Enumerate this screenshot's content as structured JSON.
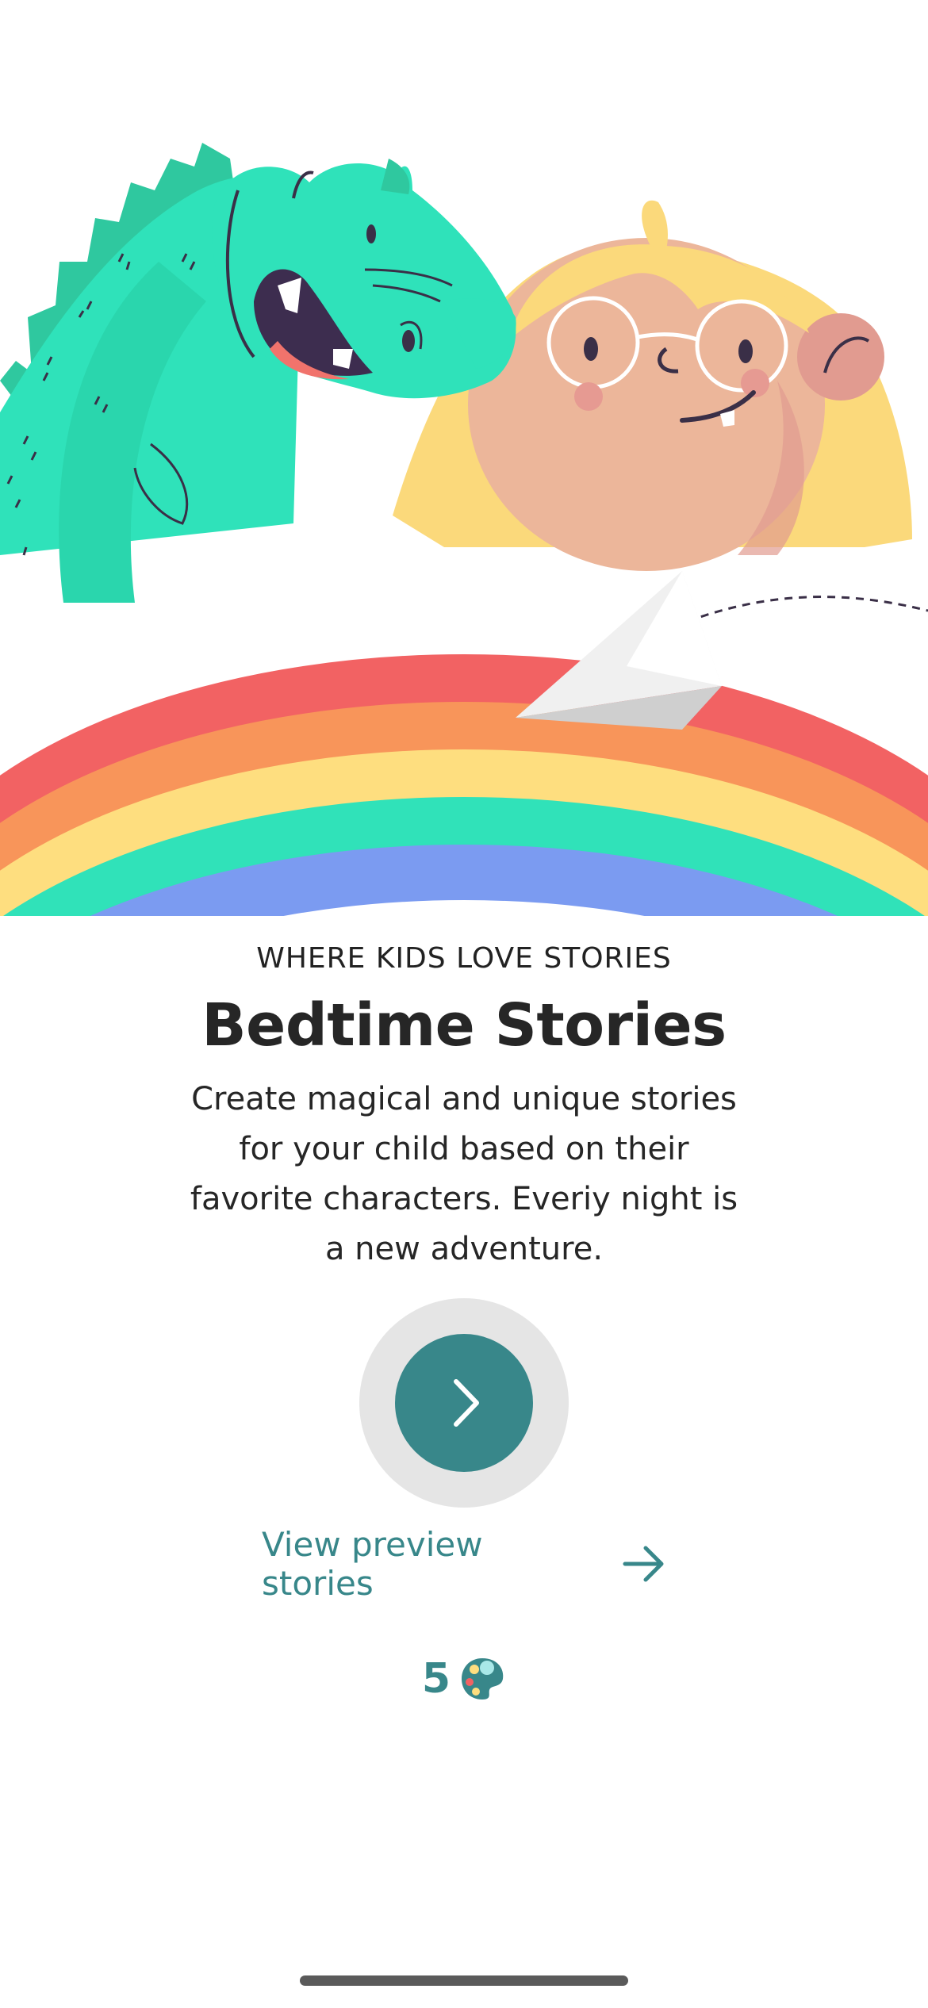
{
  "onboarding": {
    "eyebrow": "WHERE KIDS LOVE STORIES",
    "title": "Bedtime Stories",
    "description": "Create magical and unique stories for your child based on their favorite characters. Everiy night is a new adventure."
  },
  "actions": {
    "next_icon": "chevron-right-icon",
    "preview_label": "View preview stories",
    "preview_icon": "arrow-right-icon"
  },
  "credits": {
    "count": "5",
    "icon": "palette-icon"
  },
  "colors": {
    "accent": "#38878a",
    "button_ring": "#e5e5e5",
    "rainbow": [
      "#f26263",
      "#f8955a",
      "#fede7f",
      "#30e2b9",
      "#7b9bf1"
    ]
  }
}
